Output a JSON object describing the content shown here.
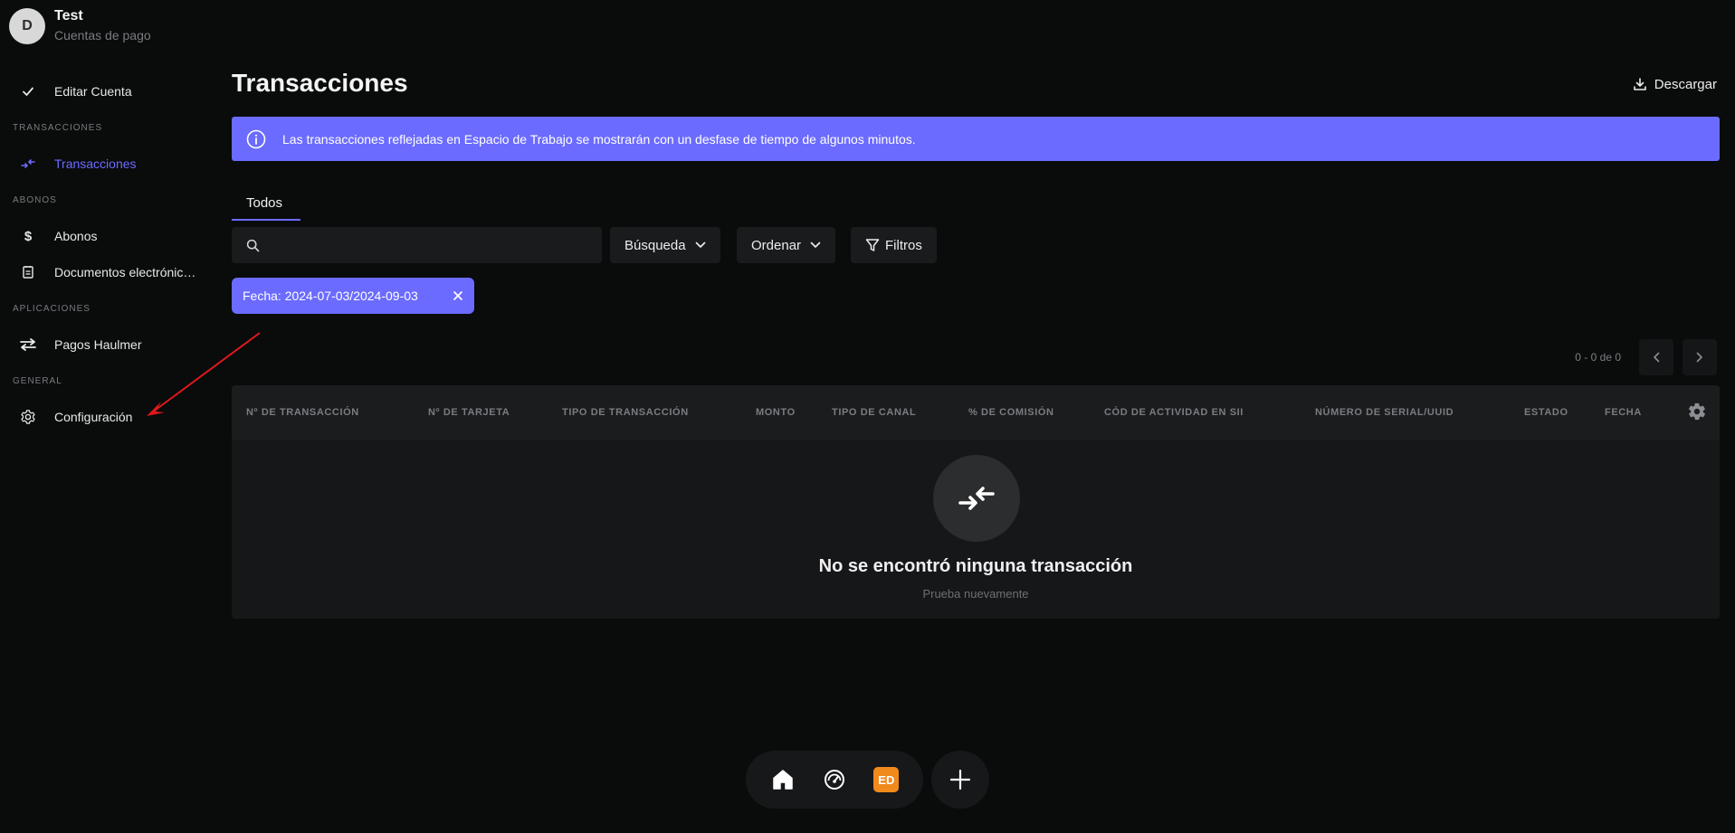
{
  "profile": {
    "initial": "D",
    "name": "Test",
    "subtitle": "Cuentas de pago"
  },
  "sidebar": {
    "edit_account": "Editar Cuenta",
    "sections": {
      "transactions": "TRANSACCIONES",
      "payments": "ABONOS",
      "applications": "APLICACIONES",
      "general": "GENERAL"
    },
    "items": {
      "transactions": "Transacciones",
      "payments": "Abonos",
      "documents": "Documentos electrónic…",
      "haulmer": "Pagos Haulmer",
      "settings": "Configuración"
    }
  },
  "header": {
    "title": "Transacciones",
    "download_label": "Descargar"
  },
  "banner": {
    "text": "Las transacciones reflejadas en Espacio de Trabajo se mostrarán con un desfase de tiempo de algunos minutos."
  },
  "tabs": {
    "all": "Todos"
  },
  "toolbar": {
    "search_value": "",
    "search_label": "Búsqueda",
    "sort_label": "Ordenar",
    "filters_label": "Filtros"
  },
  "filter_chip": {
    "label": "Fecha: 2024-07-03/2024-09-03"
  },
  "pagination": {
    "text": "0 - 0 de 0"
  },
  "table": {
    "columns": [
      "Nº DE TRANSACCIÓN",
      "Nº DE TARJETA",
      "TIPO DE TRANSACCIÓN",
      "MONTO",
      "TIPO DE CANAL",
      "% DE COMISIÓN",
      "CÓD DE ACTIVIDAD EN SII",
      "NÚMERO DE SERIAL/UUID",
      "ESTADO",
      "FECHA"
    ],
    "empty_title": "No se encontró ninguna transacción",
    "empty_subtitle": "Prueba nuevamente"
  },
  "dock": {
    "badge_label": "ED"
  },
  "colors": {
    "accent": "#6b6bff",
    "background": "#0a0b0b",
    "badge": "#f08a1c",
    "annotation": "#e0181b"
  }
}
